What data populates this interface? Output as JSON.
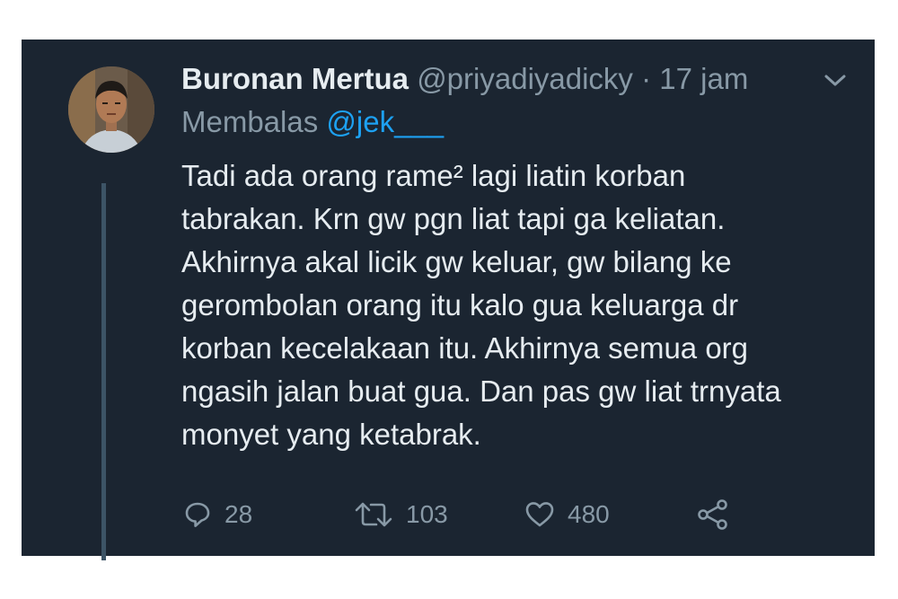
{
  "author": {
    "name": "Buronan Mertua",
    "handle": "@priyadiyadicky",
    "separator": "·",
    "timestamp": "17 jam"
  },
  "reply_to": {
    "prefix": "Membalas",
    "handle": "@jek___"
  },
  "body_lines": [
    "Tadi ada orang rame² lagi liatin korban",
    "tabrakan. Krn gw pgn liat tapi ga keliatan.",
    "Akhirnya akal licik gw keluar, gw bilang ke",
    "gerombolan orang itu kalo gua keluarga dr",
    "korban kecelakaan itu. Akhirnya semua org",
    "ngasih jalan buat gua. Dan pas gw liat trnyata",
    "monyet yang ketabrak."
  ],
  "actions": {
    "reply": {
      "icon": "reply-icon",
      "count": "28"
    },
    "retweet": {
      "icon": "retweet-icon",
      "count": "103"
    },
    "like": {
      "icon": "heart-icon",
      "count": "480"
    },
    "share": {
      "icon": "share-icon"
    }
  },
  "colors": {
    "background": "#1b2531",
    "text": "#e6ecf0",
    "muted": "#8899a6",
    "link": "#1da1f2"
  }
}
